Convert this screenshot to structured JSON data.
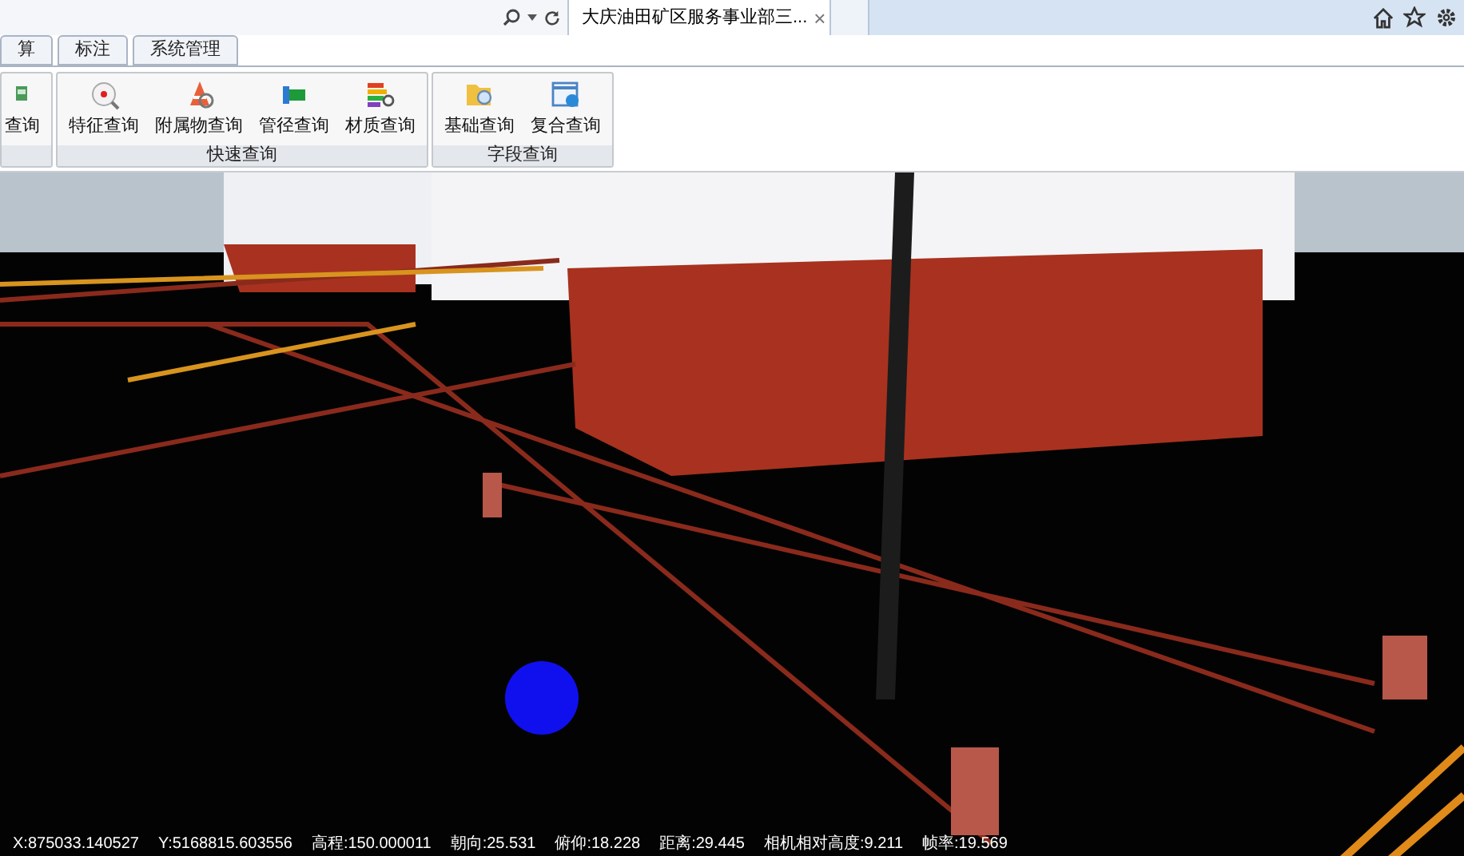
{
  "browser": {
    "tab_title": "大庆油田矿区服务事业部三...",
    "close": "×"
  },
  "tabs": [
    {
      "label": "算",
      "selected": false
    },
    {
      "label": "标注",
      "selected": false
    },
    {
      "label": "系统管理",
      "selected": false
    }
  ],
  "ribbon_groups": [
    {
      "buttons": [
        {
          "label": "查询",
          "kind": "cut"
        }
      ]
    },
    {
      "title": "快速查询",
      "buttons": [
        {
          "label": "特征查询",
          "kind": "target"
        },
        {
          "label": "附属物查询",
          "kind": "cone"
        },
        {
          "label": "管径查询",
          "kind": "pipe"
        },
        {
          "label": "材质查询",
          "kind": "layers"
        }
      ]
    },
    {
      "title": "字段查询",
      "buttons": [
        {
          "label": "基础查询",
          "kind": "folder"
        },
        {
          "label": "复合查询",
          "kind": "window"
        }
      ]
    }
  ],
  "status_bar": [
    "X:875033.140527",
    "Y:5168815.603556",
    "高程:150.000011",
    "朝向:25.531",
    "俯仰:18.228",
    "距离:29.445",
    "相机相对高度:9.211",
    "帧率:19.569"
  ]
}
